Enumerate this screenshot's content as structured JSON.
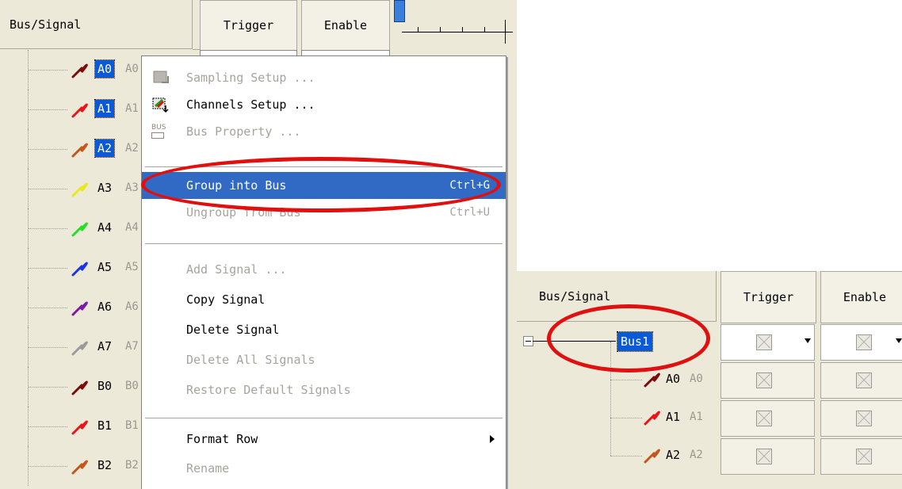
{
  "left": {
    "header": {
      "bus_signal": "Bus/Signal",
      "trigger": "Trigger",
      "enable": "Enable"
    },
    "signals": [
      {
        "name": "A0",
        "alias": "A0",
        "color": "#7a0c0c",
        "selected": true
      },
      {
        "name": "A1",
        "alias": "A1",
        "color": "#e6151a",
        "selected": true
      },
      {
        "name": "A2",
        "alias": "A2",
        "color": "#c3561a",
        "selected": true
      },
      {
        "name": "A3",
        "alias": "A3",
        "color": "#e8e81a",
        "selected": false
      },
      {
        "name": "A4",
        "alias": "A4",
        "color": "#24e024",
        "selected": false
      },
      {
        "name": "A5",
        "alias": "A5",
        "color": "#1a36e0",
        "selected": false
      },
      {
        "name": "A6",
        "alias": "A6",
        "color": "#7a1aa6",
        "selected": false
      },
      {
        "name": "A7",
        "alias": "A7",
        "color": "#9a9a9a",
        "selected": false
      },
      {
        "name": "B0",
        "alias": "B0",
        "color": "#7a0c0c",
        "selected": false
      },
      {
        "name": "B1",
        "alias": "B1",
        "color": "#e6151a",
        "selected": false
      },
      {
        "name": "B2",
        "alias": "B2",
        "color": "#c3561a",
        "selected": false
      }
    ],
    "context_menu": {
      "items": [
        {
          "label": "Sampling Setup ...",
          "shortcut": "",
          "disabled": true,
          "icon": "sampling-icon"
        },
        {
          "label": "Channels Setup ...",
          "shortcut": "",
          "disabled": false,
          "icon": "channels-icon"
        },
        {
          "label": "Bus Property ...",
          "shortcut": "",
          "disabled": true,
          "icon": "bus-icon"
        },
        {
          "label": "Group into Bus",
          "shortcut": "Ctrl+G",
          "disabled": false,
          "highlighted": true
        },
        {
          "label": "Ungroup from Bus",
          "shortcut": "Ctrl+U",
          "disabled": true
        },
        {
          "label": "Add Signal ...",
          "shortcut": "",
          "disabled": true
        },
        {
          "label": "Copy Signal",
          "shortcut": "",
          "disabled": false
        },
        {
          "label": "Delete Signal",
          "shortcut": "",
          "disabled": false
        },
        {
          "label": "Delete All Signals",
          "shortcut": "",
          "disabled": true
        },
        {
          "label": "Restore Default Signals",
          "shortcut": "",
          "disabled": true
        },
        {
          "label": "Format Row",
          "shortcut": "",
          "disabled": false,
          "submenu": true
        },
        {
          "label": "Rename",
          "shortcut": "",
          "disabled": true
        }
      ],
      "icon_bus_text": "BUS"
    }
  },
  "right": {
    "header": {
      "bus_signal": "Bus/Signal",
      "trigger": "Trigger",
      "enable": "Enable"
    },
    "bus": {
      "name": "Bus1"
    },
    "signals": [
      {
        "name": "A0",
        "alias": "A0",
        "color": "#7a0c0c"
      },
      {
        "name": "A1",
        "alias": "A1",
        "color": "#e6151a"
      },
      {
        "name": "A2",
        "alias": "A2",
        "color": "#c3561a"
      }
    ]
  },
  "colors": {
    "highlight": "#316ac5",
    "selection": "#0a59d6",
    "annotation": "#e01010"
  }
}
